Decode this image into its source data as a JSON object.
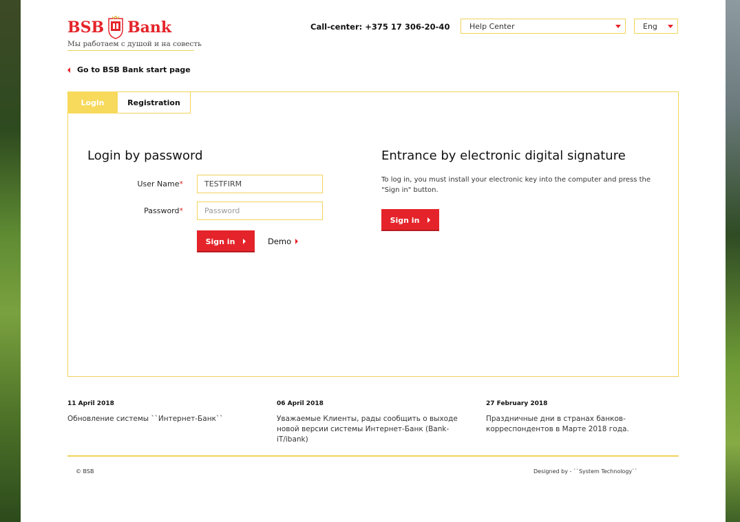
{
  "header": {
    "logo": {
      "word1": "BSB",
      "word2": "Bank",
      "tagline": "Мы работаем с душой и на совесть"
    },
    "callcenter": "Call-center: +375 17 306-20-40",
    "help_center": "Help Center",
    "language": "Eng"
  },
  "back_link": "Go to BSB Bank start page",
  "tabs": [
    {
      "label": "Login",
      "active": true
    },
    {
      "label": "Registration",
      "active": false
    }
  ],
  "login_password": {
    "title": "Login by password",
    "username_label": "User Name",
    "username_value": "TESTFIRM",
    "password_label": "Password",
    "password_placeholder": "Password",
    "sign_in": "Sign in",
    "demo": "Demo"
  },
  "digital_signature": {
    "title": "Entrance by electronic digital signature",
    "text": "To log in, you must install your electronic key into the computer and press the \"Sign in\" button.",
    "sign_in": "Sign in"
  },
  "news": [
    {
      "date": "11 April 2018",
      "text": "Обновление системы ``Интернет-Банк``"
    },
    {
      "date": "06 April 2018",
      "text": "Уважаемые Клиенты, рады сообщить о выходе новой версии системы Интернет-Банк (Bank-iT/ibank)"
    },
    {
      "date": "27 February 2018",
      "text": "Праздничные дни в странах банков-корреспондентов в Марте 2018 года."
    }
  ],
  "footer": {
    "copyright": "© BSB",
    "designed_by": "Designed by - ``System Technology``"
  },
  "colors": {
    "brand_red": "#e4242a",
    "accent_yellow": "#f2d25a",
    "tab_active": "#f7d95c"
  }
}
